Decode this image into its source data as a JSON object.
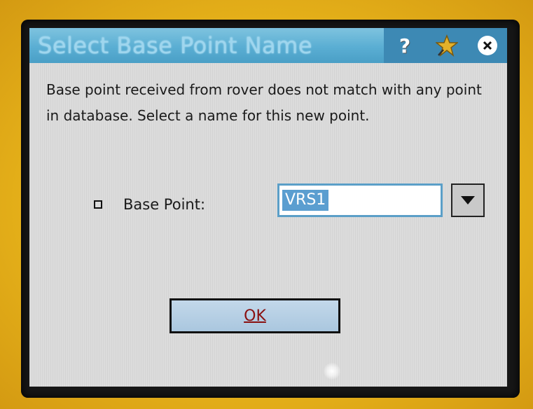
{
  "dialog": {
    "title": "Select Base Point Name",
    "message": "Base point received from rover does not match with any point in database.  Select a name for this new point.",
    "titlebar_icons": [
      "help-icon",
      "pin-icon",
      "close-icon"
    ]
  },
  "base_point": {
    "label": "Base Point:",
    "selected_value": "VRS1"
  },
  "actions": {
    "ok_label": "OK"
  },
  "colors": {
    "titlebar": "#5aaed3",
    "titlebar_buttons": "#3d89b4",
    "selection": "#5b9ed0",
    "ok_text": "#8a1010",
    "device_body": "#e6b21a"
  }
}
